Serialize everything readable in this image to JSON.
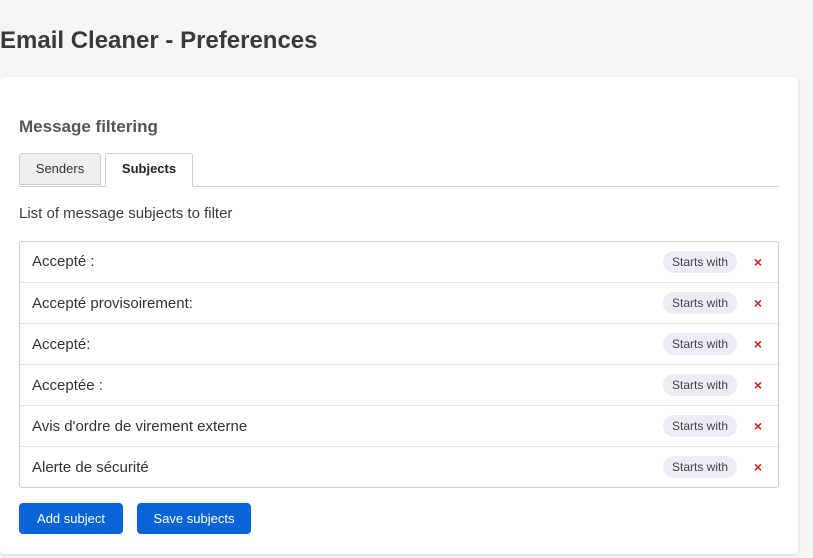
{
  "page": {
    "title": "Email Cleaner - Preferences"
  },
  "section": {
    "title": "Message filtering"
  },
  "tabs": [
    {
      "label": "Senders",
      "active": false
    },
    {
      "label": "Subjects",
      "active": true
    }
  ],
  "subjects_panel": {
    "description": "List of message subjects to filter",
    "items": [
      {
        "text": "Accepté :",
        "match": "Starts with"
      },
      {
        "text": "Accepté provisoirement:",
        "match": "Starts with"
      },
      {
        "text": "Accepté:",
        "match": "Starts with"
      },
      {
        "text": "Acceptée :",
        "match": "Starts with"
      },
      {
        "text": "Avis d'ordre de virement externe",
        "match": "Starts with"
      },
      {
        "text": "Alerte de sécurité",
        "match": "Starts with"
      }
    ],
    "remove_glyph": "×",
    "remove_icon": "close-icon"
  },
  "actions": {
    "add_label": "Add subject",
    "save_label": "Save subjects"
  },
  "colors": {
    "primary_button": "#0a64d8",
    "remove_icon": "#d12020",
    "badge_background": "#ececf6"
  }
}
